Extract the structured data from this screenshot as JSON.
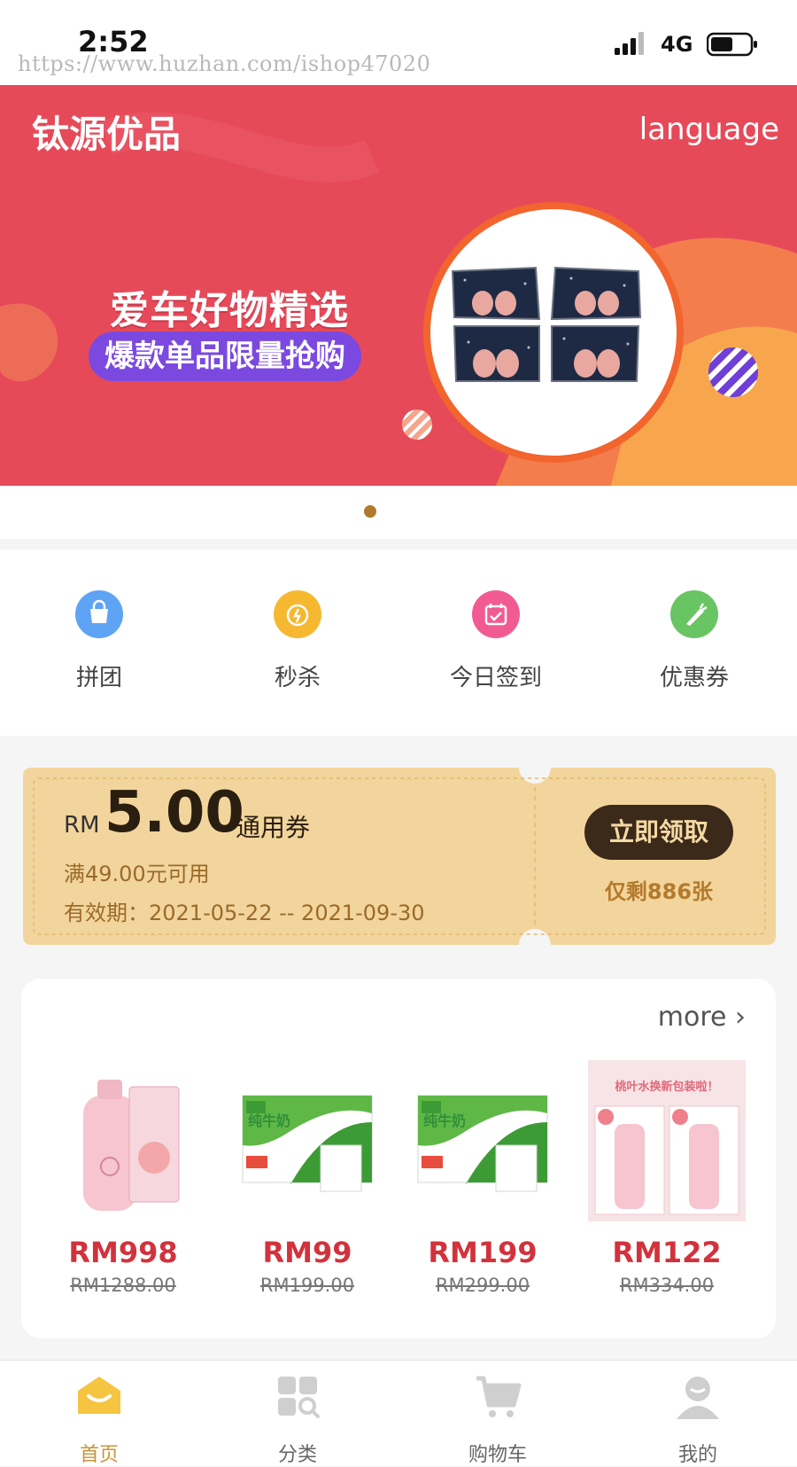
{
  "status_bar": {
    "time": "2:52",
    "watermark": "https://www.huzhan.com/ishop47020",
    "network": "4G"
  },
  "banner": {
    "brand": "钛源优品",
    "language_label": "language",
    "headline": "爱车好物精选",
    "subline": "爆款单品限量抢购",
    "page_indicator": {
      "current": 1,
      "total": 1
    },
    "colors": {
      "background": "#e64a59",
      "accent": "#7b49e0",
      "indicator": "#b07a2a"
    }
  },
  "quick_actions": [
    {
      "label": "拼团",
      "icon": "bag-icon",
      "color": "#5fa3f5"
    },
    {
      "label": "秒杀",
      "icon": "alarm-clock-icon",
      "color": "#f5b830"
    },
    {
      "label": "今日签到",
      "icon": "calendar-check-icon",
      "color": "#f25b92"
    },
    {
      "label": "优惠券",
      "icon": "carrot-coupon-icon",
      "color": "#69c463"
    }
  ],
  "coupon": {
    "currency": "RM",
    "amount": "5.00",
    "type": "通用券",
    "min_spend": "满49.00元可用",
    "validity": "有效期：2021-05-22 -- 2021-09-30",
    "claim_label": "立即领取",
    "remaining": "仅剩886张",
    "colors": {
      "background": "#f2d59c",
      "button": "#3b2a1a"
    }
  },
  "products": {
    "more_label": "more",
    "items": [
      {
        "price": "RM998",
        "original_price": "RM1288.00",
        "image": "pink-lotion-bottle"
      },
      {
        "price": "RM99",
        "original_price": "RM199.00",
        "image": "milk-box"
      },
      {
        "price": "RM199",
        "original_price": "RM299.00",
        "image": "milk-box"
      },
      {
        "price": "RM122",
        "original_price": "RM334.00",
        "image": "peach-lotion-pair",
        "image_text": "桃叶水换新包装啦！"
      }
    ],
    "price_color": "#d2323c"
  },
  "tabbar": {
    "items": [
      {
        "label": "首页",
        "icon": "home-icon",
        "active": true
      },
      {
        "label": "分类",
        "icon": "category-icon",
        "active": false
      },
      {
        "label": "购物车",
        "icon": "cart-icon",
        "active": false
      },
      {
        "label": "我的",
        "icon": "user-icon",
        "active": false
      }
    ],
    "active_color": "#c8943c"
  }
}
